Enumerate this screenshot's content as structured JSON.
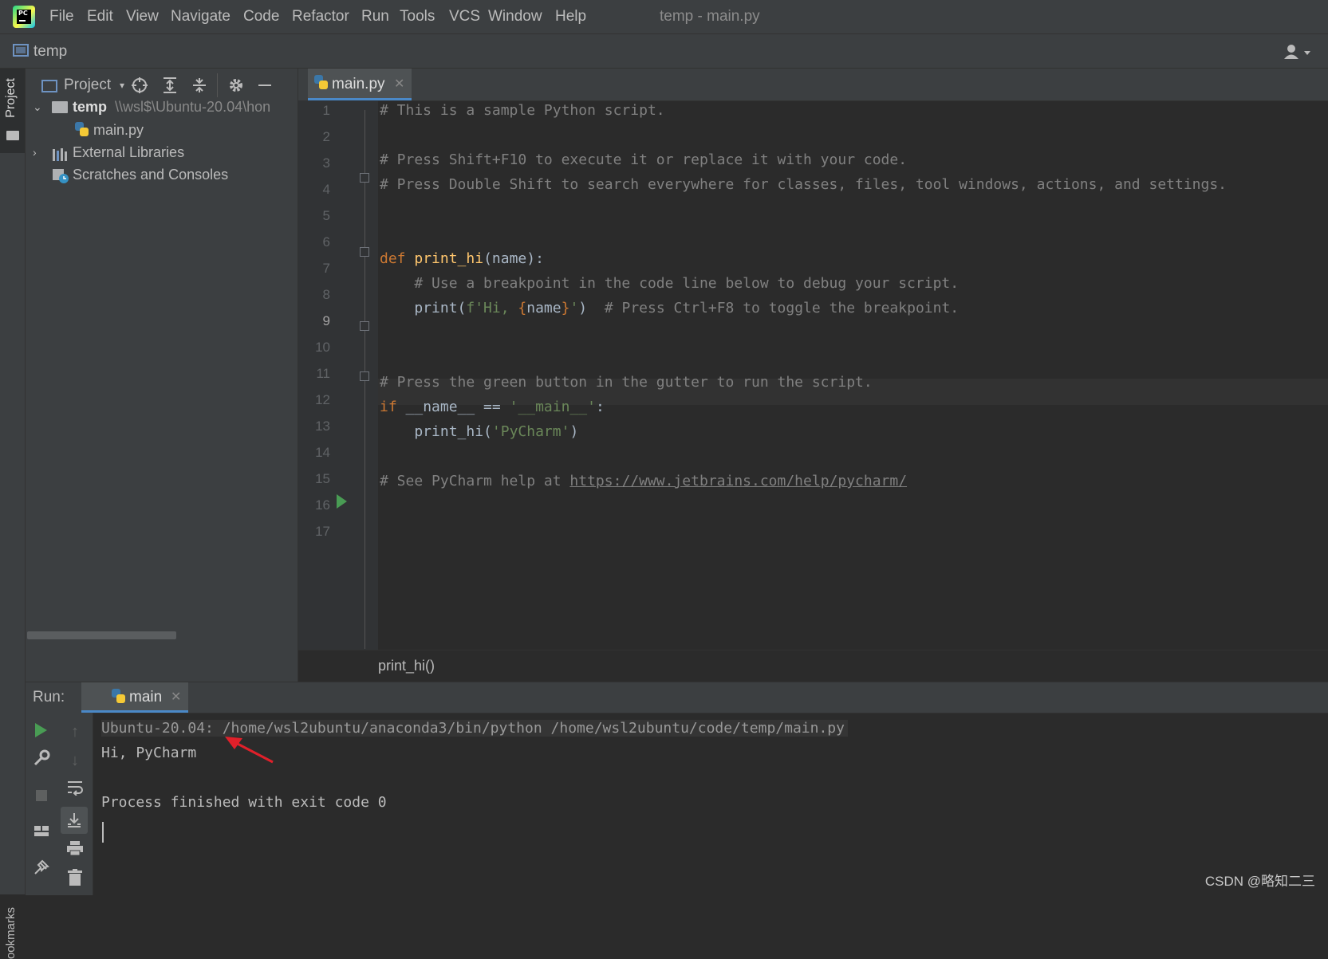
{
  "menubar": {
    "items": [
      "File",
      "Edit",
      "View",
      "Navigate",
      "Code",
      "Refactor",
      "Run",
      "Tools",
      "VCS",
      "Window",
      "Help"
    ],
    "title": "temp - main.py"
  },
  "navbar": {
    "project": "temp"
  },
  "left_strip": {
    "project_tab": "Project",
    "bookmarks_tab": "ookmarks"
  },
  "project_panel": {
    "header": "Project",
    "tree": {
      "root_name": "temp",
      "root_path": "\\\\wsl$\\Ubuntu-20.04\\hon",
      "file": "main.py",
      "external": "External Libraries",
      "scratches": "Scratches and Consoles"
    }
  },
  "editor": {
    "tab": "main.py",
    "line_numbers": [
      "1",
      "2",
      "3",
      "4",
      "5",
      "6",
      "7",
      "8",
      "9",
      "10",
      "11",
      "12",
      "13",
      "14",
      "15",
      "16",
      "17"
    ],
    "current_line": "9",
    "lines": {
      "l1": "# This is a sample Python script.",
      "l3": "# Press Shift+F10 to execute it or replace it with your code.",
      "l4": "# Press Double Shift to search everywhere for classes, files, tool windows, actions, and settings.",
      "l7_kw": "def ",
      "l7_fn": "print_hi",
      "l7_rest": "(name):",
      "l8": "    # Use a breakpoint in the code line below to debug your script.",
      "l9_a": "    print(",
      "l9_str1": "f'Hi, ",
      "l9_br1": "{",
      "l9_name": "name",
      "l9_br2": "}",
      "l9_str2": "'",
      "l9_b": ")  ",
      "l9_com": "# Press Ctrl+F8 to toggle the breakpoint.",
      "l12": "# Press the green button in the gutter to run the script.",
      "l13_kw": "if ",
      "l13_rest": "__name__ == ",
      "l13_str": "'__main__'",
      "l13_colon": ":",
      "l14_a": "    print_hi(",
      "l14_str": "'PyCharm'",
      "l14_b": ")",
      "l16_com": "# See PyCharm help at ",
      "l16_link": "https://www.jetbrains.com/help/pycharm/"
    },
    "breadcrumb": "print_hi()"
  },
  "run_panel": {
    "label": "Run:",
    "tab": "main",
    "console": {
      "cmd": "Ubuntu-20.04: /home/wsl2ubuntu/anaconda3/bin/python /home/wsl2ubuntu/code/temp/main.py",
      "out": "Hi, PyCharm",
      "exit": "Process finished with exit code 0"
    }
  },
  "watermark": "CSDN @略知二三",
  "colors": {
    "background": "#2b2b2b",
    "panel": "#3c3f41",
    "comment": "#808080",
    "keyword": "#cc7832",
    "function": "#ffc66d",
    "string": "#6a8759",
    "run_green": "#499c54",
    "arrow_red": "#e0202a"
  }
}
